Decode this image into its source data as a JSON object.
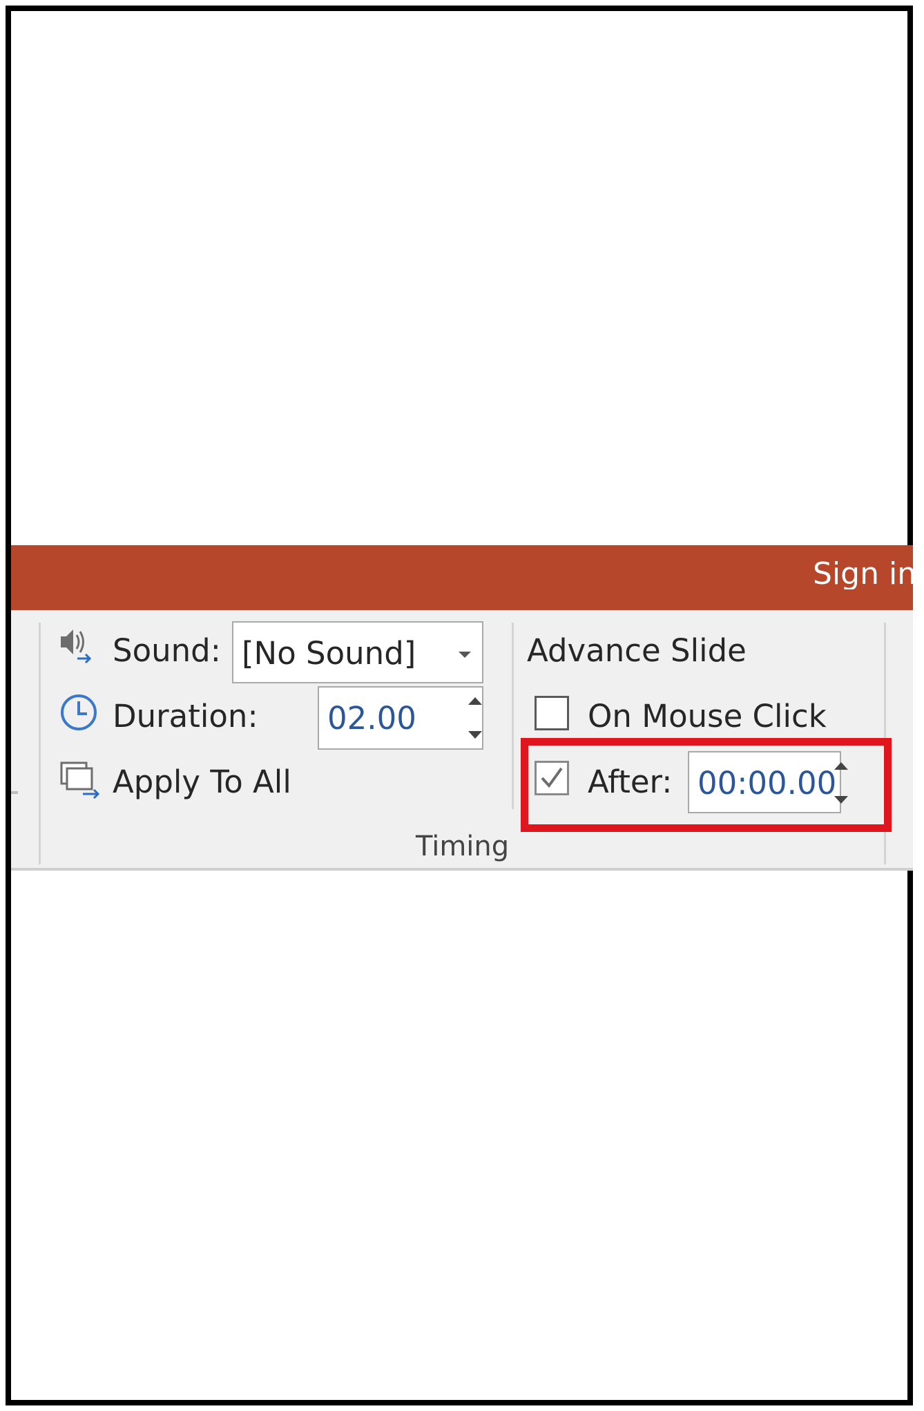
{
  "titlebar": {
    "sign_in_label": "Sign in",
    "color": "#b7472a"
  },
  "timing_group": {
    "group_label": "Timing",
    "sound": {
      "label": "Sound:",
      "value": "[No Sound]",
      "icon": "speaker-icon"
    },
    "duration": {
      "label": "Duration:",
      "value": "02.00",
      "icon": "clock-icon"
    },
    "apply_to_all": {
      "label": "Apply To All",
      "icon": "apply-to-all-icon"
    },
    "advance_slide": {
      "heading": "Advance Slide",
      "on_mouse_click": {
        "label": "On Mouse Click",
        "checked": false
      },
      "after": {
        "label": "After:",
        "checked": true,
        "value": "00:00.00"
      }
    }
  },
  "highlight": {
    "color": "#e0161e",
    "target": "after"
  },
  "colors": {
    "ribbon_bg": "#f0f0f0",
    "value_text": "#2b579a"
  }
}
